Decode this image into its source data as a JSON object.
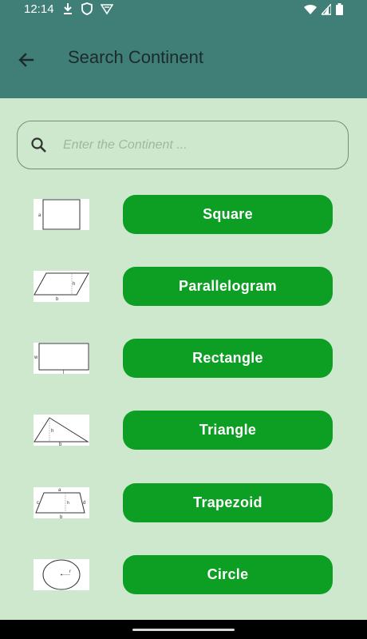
{
  "status_bar": {
    "time": "12:14",
    "icons": [
      "download-icon",
      "shield-icon",
      "vpn-key-icon",
      "wifi-icon",
      "signal-icon",
      "battery-icon"
    ]
  },
  "app_bar": {
    "title": "Search Continent",
    "back_icon": "arrow-back-icon"
  },
  "search": {
    "placeholder": "Enter the Continent ...",
    "value": ""
  },
  "shapes": [
    {
      "label": "Square",
      "thumb_label": "a"
    },
    {
      "label": "Parallelogram",
      "thumb_labels": [
        "b",
        "h"
      ]
    },
    {
      "label": "Rectangle",
      "thumb_labels": [
        "w",
        "l"
      ]
    },
    {
      "label": "Triangle",
      "thumb_labels": [
        "h",
        "b"
      ]
    },
    {
      "label": "Trapezoid",
      "thumb_labels": [
        "a",
        "b",
        "c",
        "d",
        "h"
      ]
    },
    {
      "label": "Circle",
      "thumb_label": "r"
    }
  ],
  "colors": {
    "app_bar": "#3f7f78",
    "background": "#cde8cc",
    "button": "#0c9f24",
    "button_text": "#ffffff"
  }
}
